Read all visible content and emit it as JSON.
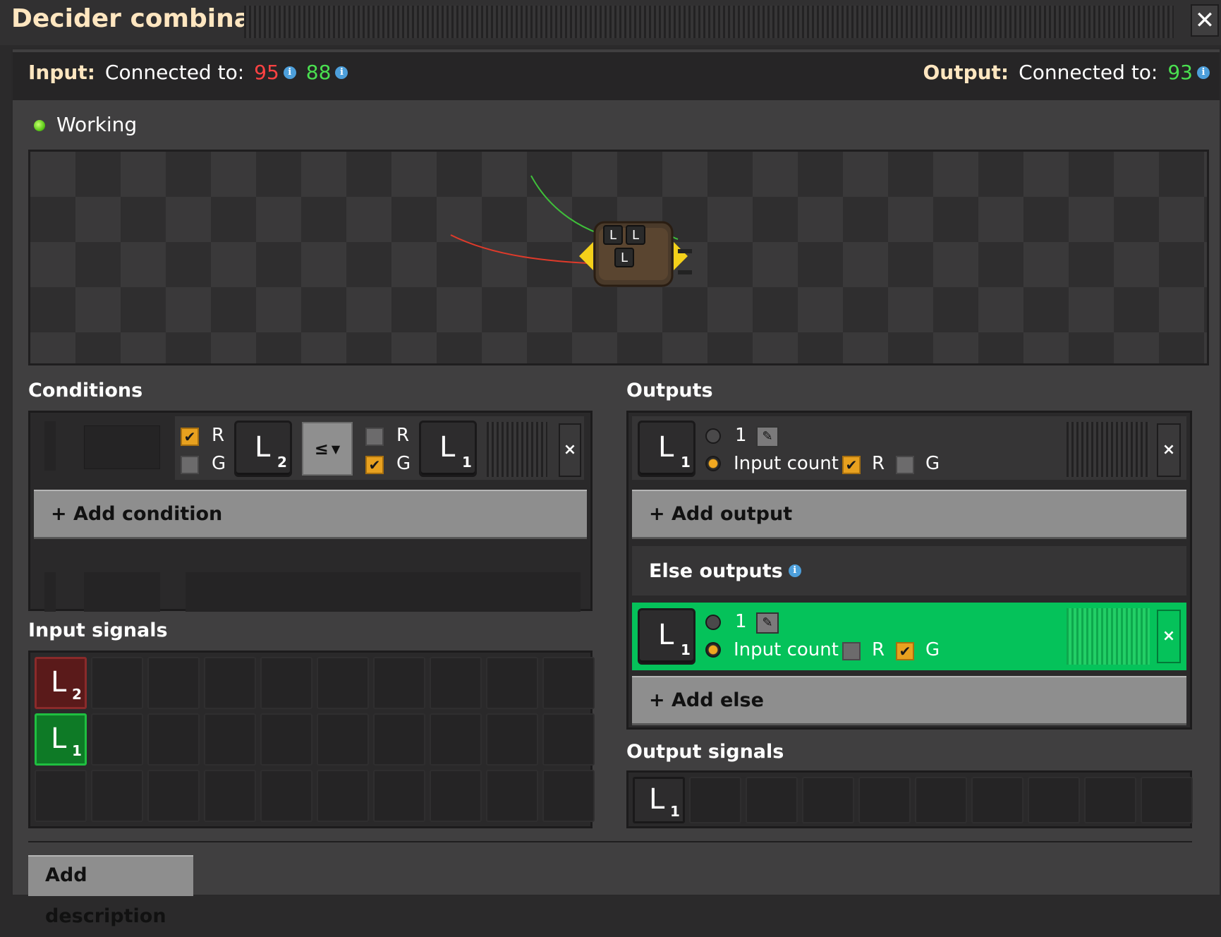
{
  "window": {
    "title": "Decider combinator",
    "close_label": "✕"
  },
  "connection": {
    "input_label": "Input:",
    "input_connected_label": "Connected to:",
    "input_red": "95",
    "input_green": "88",
    "output_label": "Output:",
    "output_connected_label": "Connected to:",
    "output_green": "93",
    "info_glyph": "i"
  },
  "status": {
    "text": "Working",
    "color": "#5ecb1a"
  },
  "preview": {
    "badges": [
      "L",
      "L",
      "L"
    ]
  },
  "conditions": {
    "title": "Conditions",
    "row": {
      "left_r": "R",
      "left_g": "G",
      "left_r_checked": true,
      "left_g_checked": false,
      "left_signal": "L",
      "left_signal_sub": "2",
      "comparator": "≤",
      "right_r": "R",
      "right_g": "G",
      "right_r_checked": false,
      "right_g_checked": true,
      "right_signal": "L",
      "right_signal_sub": "1",
      "remove": "×"
    },
    "add_label": "+ Add condition"
  },
  "outputs": {
    "title": "Outputs",
    "row": {
      "signal": "L",
      "signal_sub": "1",
      "constant_value": "1",
      "input_count_label": "Input count",
      "r_label": "R",
      "g_label": "G",
      "r_checked": true,
      "g_checked": false,
      "remove": "×"
    },
    "add_label": "+ Add output",
    "else_title": "Else outputs",
    "else_row": {
      "signal": "L",
      "signal_sub": "1",
      "constant_value": "1",
      "input_count_label": "Input count",
      "r_label": "R",
      "g_label": "G",
      "r_checked": false,
      "g_checked": true,
      "remove": "×",
      "highlight_color": "#05c25a"
    },
    "add_else_label": "+ Add else"
  },
  "input_signals": {
    "title": "Input signals",
    "items": [
      {
        "signal": "L",
        "sub": "2",
        "wire": "red"
      },
      {
        "signal": "L",
        "sub": "1",
        "wire": "green"
      }
    ]
  },
  "output_signals": {
    "title": "Output signals",
    "items": [
      {
        "signal": "L",
        "sub": "1"
      }
    ]
  },
  "footer": {
    "add_description": "Add description"
  }
}
